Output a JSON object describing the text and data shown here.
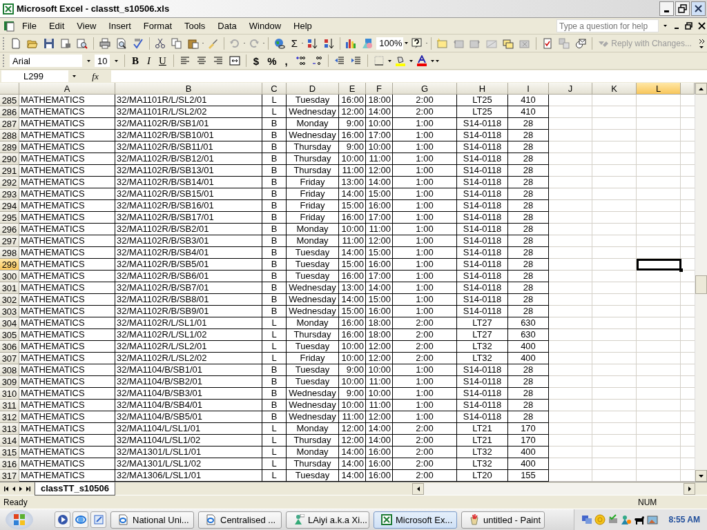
{
  "window": {
    "title": "Microsoft Excel - classtt_s10506.xls"
  },
  "menu": {
    "items": [
      "File",
      "Edit",
      "View",
      "Insert",
      "Format",
      "Tools",
      "Data",
      "Window",
      "Help"
    ],
    "help_box": {
      "placeholder": "Type a question for help"
    }
  },
  "standard_toolbar": {
    "sum": "Σ",
    "zoom": "100%",
    "reply": "Reply with Changes..."
  },
  "formatting_toolbar": {
    "font": "Arial",
    "size": "10",
    "bold": "B",
    "italic": "I",
    "underline": "U",
    "currency": "$",
    "percent": "%",
    "comma": ","
  },
  "formula_bar": {
    "name_box": "L299",
    "function_label": "fx"
  },
  "sheet": {
    "columns": [
      {
        "label": "A",
        "selected": false
      },
      {
        "label": "B",
        "selected": false
      },
      {
        "label": "C",
        "selected": false
      },
      {
        "label": "D",
        "selected": false
      },
      {
        "label": "E",
        "selected": false
      },
      {
        "label": "F",
        "selected": false
      },
      {
        "label": "G",
        "selected": false
      },
      {
        "label": "H",
        "selected": false
      },
      {
        "label": "I",
        "selected": false
      },
      {
        "label": "J",
        "selected": false
      },
      {
        "label": "K",
        "selected": false
      },
      {
        "label": "L",
        "selected": true
      }
    ],
    "rows": [
      {
        "header": "285",
        "selected": false,
        "cells": [
          "MATHEMATICS",
          "32/MA1101R/L/SL2/01",
          "L",
          "Tuesday",
          "16:00",
          "18:00",
          "2:00",
          "LT25",
          "410"
        ]
      },
      {
        "header": "286",
        "selected": false,
        "cells": [
          "MATHEMATICS",
          "32/MA1101R/L/SL2/02",
          "L",
          "Wednesday",
          "12:00",
          "14:00",
          "2:00",
          "LT25",
          "410"
        ]
      },
      {
        "header": "287",
        "selected": false,
        "cells": [
          "MATHEMATICS",
          "32/MA1102R/B/SB1/01",
          "B",
          "Monday",
          "9:00",
          "10:00",
          "1:00",
          "S14-0118",
          "28"
        ]
      },
      {
        "header": "288",
        "selected": false,
        "cells": [
          "MATHEMATICS",
          "32/MA1102R/B/SB10/01",
          "B",
          "Wednesday",
          "16:00",
          "17:00",
          "1:00",
          "S14-0118",
          "28"
        ]
      },
      {
        "header": "289",
        "selected": false,
        "cells": [
          "MATHEMATICS",
          "32/MA1102R/B/SB11/01",
          "B",
          "Thursday",
          "9:00",
          "10:00",
          "1:00",
          "S14-0118",
          "28"
        ]
      },
      {
        "header": "290",
        "selected": false,
        "cells": [
          "MATHEMATICS",
          "32/MA1102R/B/SB12/01",
          "B",
          "Thursday",
          "10:00",
          "11:00",
          "1:00",
          "S14-0118",
          "28"
        ]
      },
      {
        "header": "291",
        "selected": false,
        "cells": [
          "MATHEMATICS",
          "32/MA1102R/B/SB13/01",
          "B",
          "Thursday",
          "11:00",
          "12:00",
          "1:00",
          "S14-0118",
          "28"
        ]
      },
      {
        "header": "292",
        "selected": false,
        "cells": [
          "MATHEMATICS",
          "32/MA1102R/B/SB14/01",
          "B",
          "Friday",
          "13:00",
          "14:00",
          "1:00",
          "S14-0118",
          "28"
        ]
      },
      {
        "header": "293",
        "selected": false,
        "cells": [
          "MATHEMATICS",
          "32/MA1102R/B/SB15/01",
          "B",
          "Friday",
          "14:00",
          "15:00",
          "1:00",
          "S14-0118",
          "28"
        ]
      },
      {
        "header": "294",
        "selected": false,
        "cells": [
          "MATHEMATICS",
          "32/MA1102R/B/SB16/01",
          "B",
          "Friday",
          "15:00",
          "16:00",
          "1:00",
          "S14-0118",
          "28"
        ]
      },
      {
        "header": "295",
        "selected": false,
        "cells": [
          "MATHEMATICS",
          "32/MA1102R/B/SB17/01",
          "B",
          "Friday",
          "16:00",
          "17:00",
          "1:00",
          "S14-0118",
          "28"
        ]
      },
      {
        "header": "296",
        "selected": false,
        "cells": [
          "MATHEMATICS",
          "32/MA1102R/B/SB2/01",
          "B",
          "Monday",
          "10:00",
          "11:00",
          "1:00",
          "S14-0118",
          "28"
        ]
      },
      {
        "header": "297",
        "selected": false,
        "cells": [
          "MATHEMATICS",
          "32/MA1102R/B/SB3/01",
          "B",
          "Monday",
          "11:00",
          "12:00",
          "1:00",
          "S14-0118",
          "28"
        ]
      },
      {
        "header": "298",
        "selected": false,
        "cells": [
          "MATHEMATICS",
          "32/MA1102R/B/SB4/01",
          "B",
          "Tuesday",
          "14:00",
          "15:00",
          "1:00",
          "S14-0118",
          "28"
        ]
      },
      {
        "header": "299",
        "selected": true,
        "cells": [
          "MATHEMATICS",
          "32/MA1102R/B/SB5/01",
          "B",
          "Tuesday",
          "15:00",
          "16:00",
          "1:00",
          "S14-0118",
          "28"
        ]
      },
      {
        "header": "300",
        "selected": false,
        "cells": [
          "MATHEMATICS",
          "32/MA1102R/B/SB6/01",
          "B",
          "Tuesday",
          "16:00",
          "17:00",
          "1:00",
          "S14-0118",
          "28"
        ]
      },
      {
        "header": "301",
        "selected": false,
        "cells": [
          "MATHEMATICS",
          "32/MA1102R/B/SB7/01",
          "B",
          "Wednesday",
          "13:00",
          "14:00",
          "1:00",
          "S14-0118",
          "28"
        ]
      },
      {
        "header": "302",
        "selected": false,
        "cells": [
          "MATHEMATICS",
          "32/MA1102R/B/SB8/01",
          "B",
          "Wednesday",
          "14:00",
          "15:00",
          "1:00",
          "S14-0118",
          "28"
        ]
      },
      {
        "header": "303",
        "selected": false,
        "cells": [
          "MATHEMATICS",
          "32/MA1102R/B/SB9/01",
          "B",
          "Wednesday",
          "15:00",
          "16:00",
          "1:00",
          "S14-0118",
          "28"
        ]
      },
      {
        "header": "304",
        "selected": false,
        "cells": [
          "MATHEMATICS",
          "32/MA1102R/L/SL1/01",
          "L",
          "Monday",
          "16:00",
          "18:00",
          "2:00",
          "LT27",
          "630"
        ]
      },
      {
        "header": "305",
        "selected": false,
        "cells": [
          "MATHEMATICS",
          "32/MA1102R/L/SL1/02",
          "L",
          "Thursday",
          "16:00",
          "18:00",
          "2:00",
          "LT27",
          "630"
        ]
      },
      {
        "header": "306",
        "selected": false,
        "cells": [
          "MATHEMATICS",
          "32/MA1102R/L/SL2/01",
          "L",
          "Tuesday",
          "10:00",
          "12:00",
          "2:00",
          "LT32",
          "400"
        ]
      },
      {
        "header": "307",
        "selected": false,
        "cells": [
          "MATHEMATICS",
          "32/MA1102R/L/SL2/02",
          "L",
          "Friday",
          "10:00",
          "12:00",
          "2:00",
          "LT32",
          "400"
        ]
      },
      {
        "header": "308",
        "selected": false,
        "cells": [
          "MATHEMATICS",
          "32/MA1104/B/SB1/01",
          "B",
          "Tuesday",
          "9:00",
          "10:00",
          "1:00",
          "S14-0118",
          "28"
        ]
      },
      {
        "header": "309",
        "selected": false,
        "cells": [
          "MATHEMATICS",
          "32/MA1104/B/SB2/01",
          "B",
          "Tuesday",
          "10:00",
          "11:00",
          "1:00",
          "S14-0118",
          "28"
        ]
      },
      {
        "header": "310",
        "selected": false,
        "cells": [
          "MATHEMATICS",
          "32/MA1104/B/SB3/01",
          "B",
          "Wednesday",
          "9:00",
          "10:00",
          "1:00",
          "S14-0118",
          "28"
        ]
      },
      {
        "header": "311",
        "selected": false,
        "cells": [
          "MATHEMATICS",
          "32/MA1104/B/SB4/01",
          "B",
          "Wednesday",
          "10:00",
          "11:00",
          "1:00",
          "S14-0118",
          "28"
        ]
      },
      {
        "header": "312",
        "selected": false,
        "cells": [
          "MATHEMATICS",
          "32/MA1104/B/SB5/01",
          "B",
          "Wednesday",
          "11:00",
          "12:00",
          "1:00",
          "S14-0118",
          "28"
        ]
      },
      {
        "header": "313",
        "selected": false,
        "cells": [
          "MATHEMATICS",
          "32/MA1104/L/SL1/01",
          "L",
          "Monday",
          "12:00",
          "14:00",
          "2:00",
          "LT21",
          "170"
        ]
      },
      {
        "header": "314",
        "selected": false,
        "cells": [
          "MATHEMATICS",
          "32/MA1104/L/SL1/02",
          "L",
          "Thursday",
          "12:00",
          "14:00",
          "2:00",
          "LT21",
          "170"
        ]
      },
      {
        "header": "315",
        "selected": false,
        "cells": [
          "MATHEMATICS",
          "32/MA1301/L/SL1/01",
          "L",
          "Monday",
          "14:00",
          "16:00",
          "2:00",
          "LT32",
          "400"
        ]
      },
      {
        "header": "316",
        "selected": false,
        "cells": [
          "MATHEMATICS",
          "32/MA1301/L/SL1/02",
          "L",
          "Thursday",
          "14:00",
          "16:00",
          "2:00",
          "LT32",
          "400"
        ]
      },
      {
        "header": "317",
        "selected": false,
        "cells": [
          "MATHEMATICS",
          "32/MA1306/L/SL1/01",
          "L",
          "Tuesday",
          "14:00",
          "16:00",
          "2:00",
          "LT20",
          "155"
        ]
      }
    ]
  },
  "sheet_tabs": [
    {
      "label": "classTT_s10506",
      "selected": true
    }
  ],
  "status_bar": {
    "status": "Ready",
    "indicator": "NUM"
  },
  "taskbar": {
    "tasks": [
      {
        "label": "National Uni...",
        "kind": "browser",
        "selected": false
      },
      {
        "label": "Centralised ...",
        "kind": "browser",
        "selected": false
      },
      {
        "label": "LAiyi a.k.a Xi...",
        "kind": "chat",
        "selected": false
      },
      {
        "label": "Microsoft Ex...",
        "kind": "spreadsheet",
        "selected": true
      },
      {
        "label": "untitled - Paint",
        "kind": "paint",
        "selected": false
      }
    ],
    "clock": "8:55 AM"
  }
}
